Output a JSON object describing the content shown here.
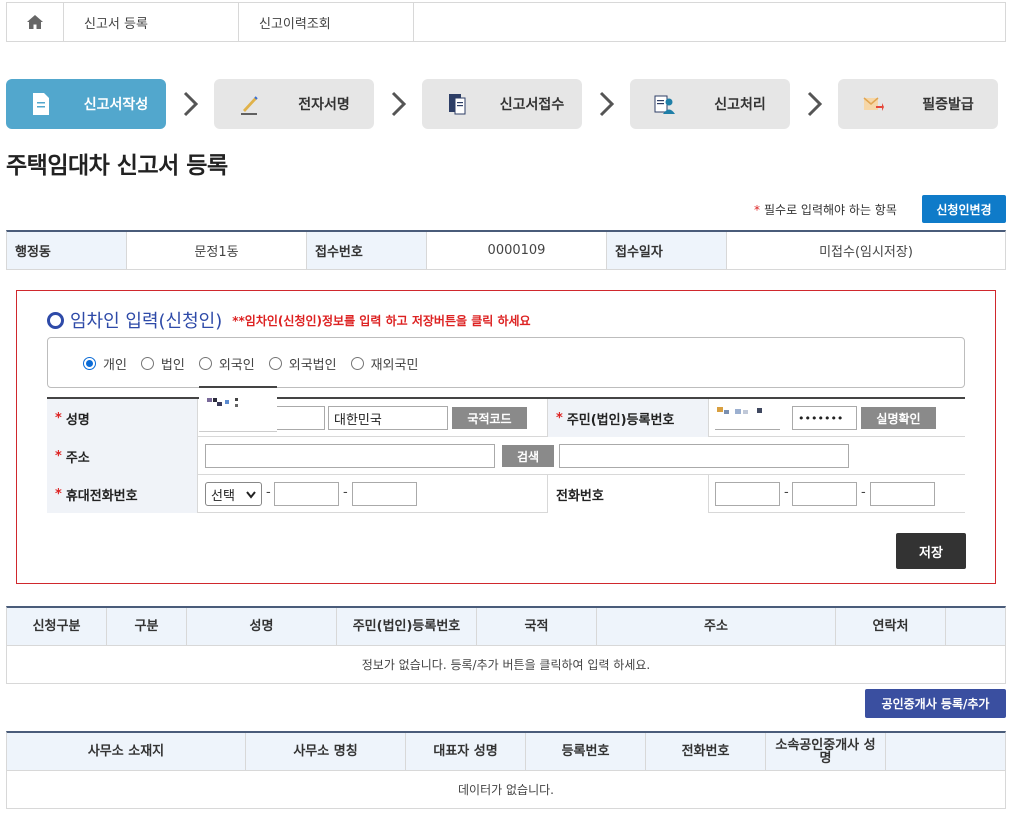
{
  "topnav": {
    "home_icon": "home-icon",
    "tabs": [
      "신고서 등록",
      "신고이력조회"
    ]
  },
  "steps": [
    {
      "label": "신고서작성",
      "icon": "document-icon",
      "active": true
    },
    {
      "label": "전자서명",
      "icon": "pen-sign-icon",
      "active": false
    },
    {
      "label": "신고서접수",
      "icon": "file-submit-icon",
      "active": false
    },
    {
      "label": "신고처리",
      "icon": "person-process-icon",
      "active": false
    },
    {
      "label": "필증발급",
      "icon": "certificate-icon",
      "active": false
    }
  ],
  "page_title": "주택임대차 신고서 등록",
  "required_note": "필수로 입력해야 하는 항목",
  "required_star": "*",
  "change_applicant_button": "신청인변경",
  "info": {
    "district_label": "행정동",
    "district_value": "문정1동",
    "receipt_no_label": "접수번호",
    "receipt_no_value": "0000109",
    "receipt_date_label": "접수일자",
    "receipt_date_value": "미접수(임시저장)"
  },
  "tenant_section": {
    "title": "임차인 입력(신청인)",
    "note": "**임차인(신청인)정보를 입력 하고 저장버튼을 클릭 하세요",
    "radio_options": [
      "개인",
      "법인",
      "외국인",
      "외국법인",
      "재외국민"
    ],
    "selected_option": "개인",
    "name_label": "성명",
    "nationality_value": "대한민국",
    "nationality_code_button": "국적코드",
    "resident_no_label": "주민(법인)등록번호",
    "resident_no_masked": "•••••••",
    "verify_button": "실명확인",
    "address_label": "주소",
    "search_button": "검색",
    "mobile_label": "휴대전화번호",
    "mobile_select": "선택",
    "phone_label": "전화번호",
    "dash": "-",
    "save_button": "저장"
  },
  "applicant_table": {
    "headers": [
      "신청구분",
      "구분",
      "성명",
      "주민(법인)등록번호",
      "국적",
      "주소",
      "연락처",
      ""
    ],
    "empty_message": "정보가 없습니다.   등록/추가 버튼을 클릭하여 입력 하세요."
  },
  "agent_button": "공인중개사 등록/추가",
  "agent_table": {
    "headers": [
      "사무소 소재지",
      "사무소 명칭",
      "대표자 성명",
      "등록번호",
      "전화번호",
      "소속공인중개사 성명",
      ""
    ],
    "empty_message": "데이터가 없습니다."
  },
  "colors": {
    "active_step": "#52a7cd",
    "inactive_step": "#e6e6e6",
    "primary_blue": "#0f7bc9",
    "navy": "#3a4fa0",
    "required_red": "#d22222",
    "section_border": "#d0282d"
  }
}
